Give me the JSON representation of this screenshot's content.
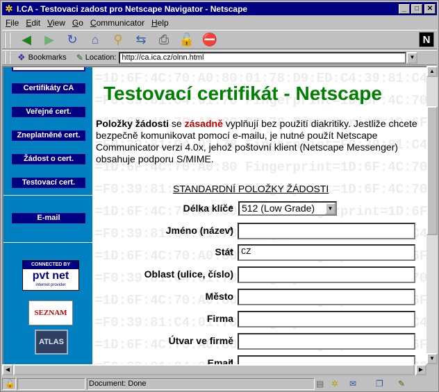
{
  "window": {
    "title": "I.CA - Testovaci zadost pro Netscape Navigator - Netscape",
    "min_symbol": "_",
    "max_symbol": "□",
    "close_symbol": "✕"
  },
  "menubar": [
    "File",
    "Edit",
    "View",
    "Go",
    "Communicator",
    "Help"
  ],
  "toolbar": {
    "icons": [
      "back-icon",
      "forward-icon",
      "reload-icon",
      "home-icon",
      "search-icon",
      "my-netscape-icon",
      "print-icon",
      "security-icon",
      "stop-icon"
    ],
    "brand": "N"
  },
  "location_bar": {
    "bookmarks_label": "Bookmarks",
    "location_label": "Location:",
    "url": "http://ca.ica.cz/olnn.html"
  },
  "sidebar": {
    "nav": [
      "Certifikáty CA",
      "Veřejné cert.",
      "Zneplatněné cert.",
      "Žádost o cert.",
      "Testovací cert.",
      "E-mail"
    ],
    "pvt_top": "CONNECTED BY",
    "pvt_mid": "pvt net",
    "pvt_bot": "internet provider",
    "seznam": "SEZNAM",
    "atlas": "ATLAS"
  },
  "page": {
    "heading": "Testovací certifikát - Netscape",
    "intro_bold": "Položky žádosti",
    "intro_mid": " se ",
    "intro_red": "zásadně",
    "intro_rest": " vyplňují bez použití diakritiky. Jestliže chcete bezpečně komunikovat pomocí e-mailu, je nutné použít Netscape Communicator verzi 4.0x, jehož poštovní klient (Netscape Messenger) obsahuje podporu S/MIME.",
    "section_title": "STANDARDNÍ POLOŽKY ŽÁDOSTI",
    "form": {
      "key_length_label": "Délka klíče",
      "key_length_value": "512 (Low Grade)",
      "name_label": "Jméno (název)",
      "name_value": "",
      "country_label": "Stát",
      "country_value": "CZ",
      "area_label": "Oblast (ulice, číslo)",
      "area_value": "",
      "city_label": "Město",
      "city_value": "",
      "company_label": "Firma",
      "company_value": "",
      "dept_label": "Útvar ve firmě",
      "dept_value": "",
      "email_label": "Email",
      "email_value": "",
      "required_mark": "*"
    },
    "watermark_lines": [
      "E=1D:6F:4C:70:A0:80:01:78:D9:ED:C4:39:81:C4",
      "E=F0:39:81:C4:61:78 Fingerprint=1D:6F:4C:70",
      "E=1D:6F:4C:70:A0:80:01:78 Fingerprint=1D:6F:4C:7",
      "E=F0:39:81:C4:01:78 Fingerprint=F0:39:81:C4",
      "E=1D:6F:4C:70:A0:80 Fingerprint=1D:6F:4C:70:",
      "E=F0:39:81:C4:01:78 Fingerprint=1D:6F:4C:70",
      "E=1D:6F:4C:70:A0:80:01:78 Fingerprint=1D:6F:4C:7",
      "E=F0:39:81:C4:01:78 Fingerprint=F0:39:81:C4",
      "E=1D:6F:4C:70:A0:80:01:78 Fingerprint=1D:6F:4C:7",
      "E=F0:39:81:C4:01:78 Fingerprint=1D:6F:4C:70",
      "E=1D:6F:4C:70:A0:80:01:78 Fingerprint=1D:6F:4C:7",
      "E=F0:39:81:C4:01:78 Fingerprint=F0:39:81:C4",
      "E=1D:6F:4C:70:A0:80:01:78 Fingerprint=1D:6F:4C:7",
      "E=F0:39:81:C4:01:78 Fingerprint=1D:6F:4C:70"
    ]
  },
  "status": {
    "text": "Document: Done"
  },
  "colors": {
    "heading": "#008000",
    "sidebar": "#0080c0",
    "nav_button": "#000080",
    "emphasis": "#c00000"
  }
}
